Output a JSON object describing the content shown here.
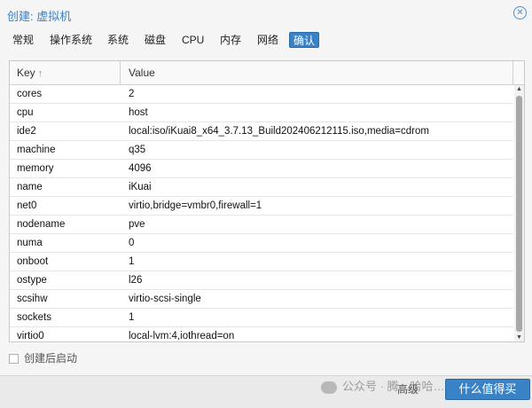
{
  "window": {
    "title": "创建: 虚拟机",
    "close_icon": "close-icon"
  },
  "tabs": [
    {
      "label": "常规"
    },
    {
      "label": "操作系统"
    },
    {
      "label": "系统"
    },
    {
      "label": "磁盘"
    },
    {
      "label": "CPU"
    },
    {
      "label": "内存"
    },
    {
      "label": "网络"
    },
    {
      "label": "确认",
      "active": true
    }
  ],
  "table": {
    "columns": {
      "key": "Key",
      "value": "Value"
    },
    "sort_indicator": "↑",
    "rows": [
      {
        "key": "cores",
        "value": "2"
      },
      {
        "key": "cpu",
        "value": "host"
      },
      {
        "key": "ide2",
        "value": "local:iso/iKuai8_x64_3.7.13_Build202406212115.iso,media=cdrom"
      },
      {
        "key": "machine",
        "value": "q35"
      },
      {
        "key": "memory",
        "value": "4096"
      },
      {
        "key": "name",
        "value": "iKuai"
      },
      {
        "key": "net0",
        "value": "virtio,bridge=vmbr0,firewall=1"
      },
      {
        "key": "nodename",
        "value": "pve"
      },
      {
        "key": "numa",
        "value": "0"
      },
      {
        "key": "onboot",
        "value": "1"
      },
      {
        "key": "ostype",
        "value": "l26"
      },
      {
        "key": "scsihw",
        "value": "virtio-scsi-single"
      },
      {
        "key": "sockets",
        "value": "1"
      },
      {
        "key": "virtio0",
        "value": "local-lvm:4,iothread=on"
      }
    ]
  },
  "options": {
    "start_after_create": "创建后启动",
    "checked": false
  },
  "footer": {
    "watermark": "公众号 · 腾…哈哈…",
    "advanced_label": "高级",
    "finish_label": "什么值得买"
  },
  "colors": {
    "accent": "#3a82c6"
  }
}
